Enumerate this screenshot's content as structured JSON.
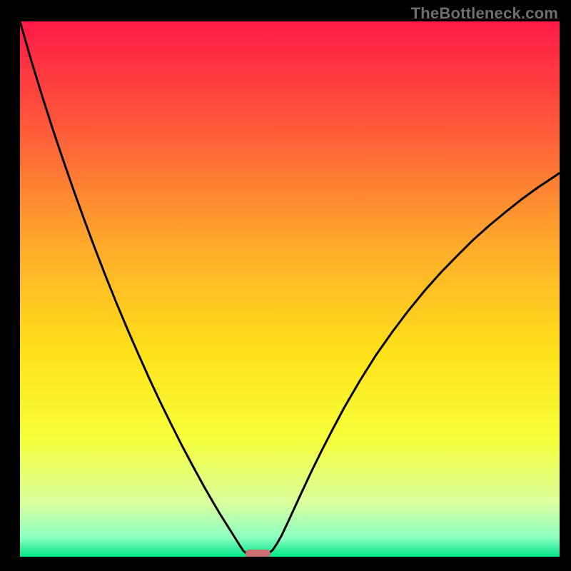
{
  "watermark": "TheBottleneck.com",
  "chart_data": {
    "type": "line",
    "title": "",
    "xlabel": "",
    "ylabel": "",
    "xlim": [
      0,
      100
    ],
    "ylim": [
      0,
      100
    ],
    "grid": false,
    "legend": false,
    "background_gradient_stops": [
      {
        "offset": 0.0,
        "color": "#ff1a47"
      },
      {
        "offset": 0.2,
        "color": "#ff5a3a"
      },
      {
        "offset": 0.42,
        "color": "#ffab2b"
      },
      {
        "offset": 0.62,
        "color": "#ffe11a"
      },
      {
        "offset": 0.78,
        "color": "#f6ff3a"
      },
      {
        "offset": 0.9,
        "color": "#d9ffa0"
      },
      {
        "offset": 0.965,
        "color": "#8affc0"
      },
      {
        "offset": 1.0,
        "color": "#00e585"
      }
    ],
    "curve_points_xy": [
      [
        0.0,
        100.0
      ],
      [
        2.0,
        93.0
      ],
      [
        4.0,
        86.4
      ],
      [
        6.0,
        80.1
      ],
      [
        8.0,
        74.1
      ],
      [
        10.0,
        68.3
      ],
      [
        12.0,
        62.7
      ],
      [
        14.0,
        57.3
      ],
      [
        16.0,
        52.1
      ],
      [
        18.0,
        47.1
      ],
      [
        20.0,
        42.3
      ],
      [
        22.0,
        37.7
      ],
      [
        24.0,
        33.2
      ],
      [
        26.0,
        28.9
      ],
      [
        28.0,
        24.8
      ],
      [
        30.0,
        20.8
      ],
      [
        32.0,
        17.0
      ],
      [
        34.0,
        13.3
      ],
      [
        36.0,
        9.8
      ],
      [
        37.0,
        8.1
      ],
      [
        38.0,
        6.5
      ],
      [
        39.0,
        4.9
      ],
      [
        40.0,
        3.3
      ],
      [
        40.8,
        2.0
      ],
      [
        41.4,
        1.1
      ],
      [
        42.0,
        0.6
      ],
      [
        42.8,
        0.6
      ],
      [
        43.6,
        0.6
      ],
      [
        44.4,
        0.6
      ],
      [
        45.2,
        0.6
      ],
      [
        46.0,
        0.6
      ],
      [
        46.8,
        1.2
      ],
      [
        47.6,
        2.4
      ],
      [
        48.5,
        4.0
      ],
      [
        50.0,
        7.2
      ],
      [
        52.0,
        11.6
      ],
      [
        54.0,
        15.9
      ],
      [
        56.0,
        20.0
      ],
      [
        58.0,
        23.9
      ],
      [
        60.0,
        27.7
      ],
      [
        63.0,
        32.9
      ],
      [
        66.0,
        37.7
      ],
      [
        69.0,
        42.0
      ],
      [
        72.0,
        46.0
      ],
      [
        75.0,
        49.7
      ],
      [
        78.0,
        53.1
      ],
      [
        81.0,
        56.2
      ],
      [
        84.0,
        59.2
      ],
      [
        87.0,
        61.9
      ],
      [
        90.0,
        64.4
      ],
      [
        93.0,
        66.8
      ],
      [
        96.0,
        69.0
      ],
      [
        99.0,
        71.0
      ],
      [
        100.0,
        71.7
      ]
    ],
    "highlight_bar": {
      "x_start": 41.8,
      "x_end": 46.4,
      "y": 0.6,
      "color": "#cc6f73"
    }
  }
}
